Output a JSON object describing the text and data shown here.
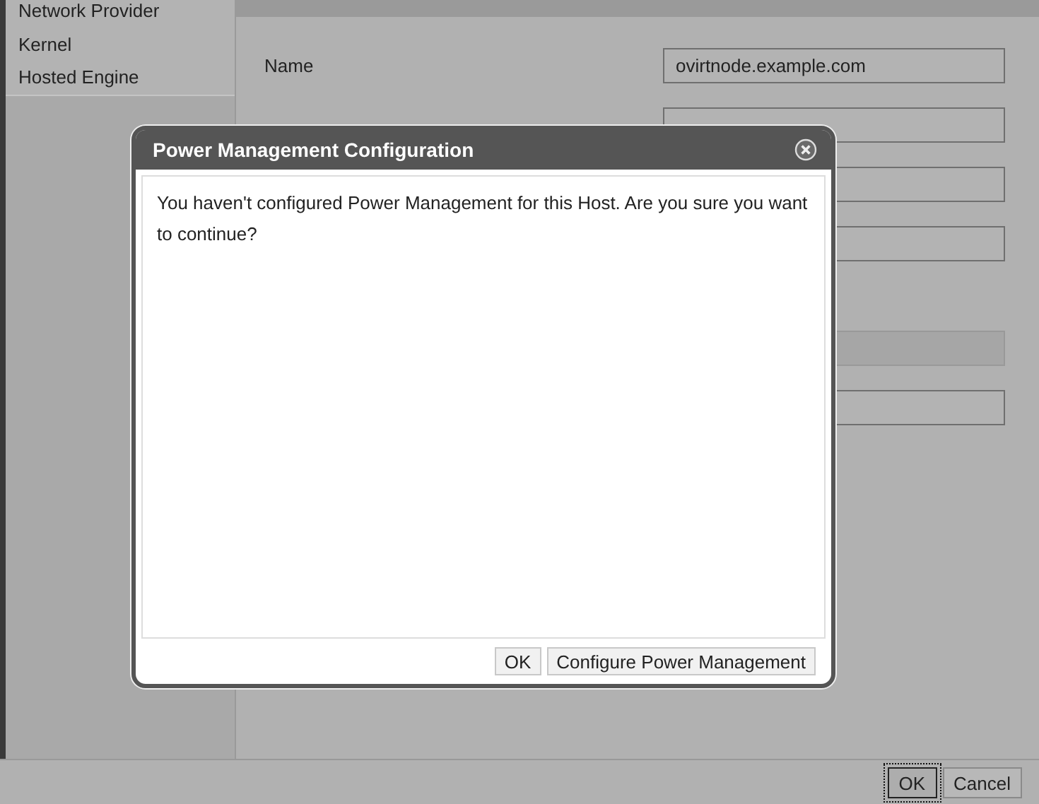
{
  "sidebar": {
    "items": [
      {
        "label": "Network Provider"
      },
      {
        "label": "Kernel"
      },
      {
        "label": "Hosted Engine"
      }
    ]
  },
  "form": {
    "fields": [
      {
        "label": "Name",
        "value": "ovirtnode.example.com",
        "disabled": false
      },
      {
        "disabled": false
      },
      {
        "disabled": false
      },
      {
        "disabled": false
      },
      {
        "disabled": true
      },
      {
        "disabled": false
      }
    ]
  },
  "dialog": {
    "title": "Power Management Configuration",
    "message": "You haven't configured Power Management for this Host. Are you sure you want to continue?",
    "buttons": [
      "OK",
      "Configure Power Management"
    ]
  },
  "footer": {
    "buttons": [
      {
        "label": "OK",
        "focused": true
      },
      {
        "label": "Cancel",
        "focused": false
      }
    ]
  }
}
